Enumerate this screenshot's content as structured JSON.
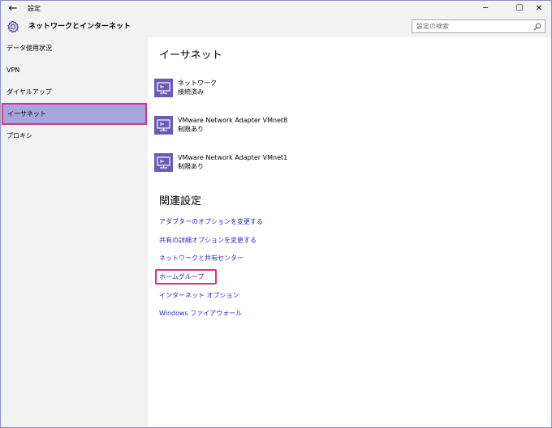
{
  "window": {
    "app_title": "設定",
    "back_glyph": "←",
    "minimize_glyph": "─",
    "maximize_glyph": "☐",
    "close_glyph": "✕"
  },
  "header": {
    "title": "ネットワークとインターネット",
    "search_placeholder": "設定の検索"
  },
  "sidebar": {
    "items": [
      {
        "label": "データ使用状況",
        "selected": false
      },
      {
        "label": "VPN",
        "selected": false
      },
      {
        "label": "ダイヤルアップ",
        "selected": false
      },
      {
        "label": "イーサネット",
        "selected": true
      },
      {
        "label": "プロキシ",
        "selected": false
      }
    ]
  },
  "main": {
    "title": "イーサネット",
    "networks": [
      {
        "name": "ネットワーク",
        "status": "接続済み",
        "icon": "ethernet-icon"
      },
      {
        "name": "VMware Network Adapter VMnet8",
        "status": "制限あり",
        "icon": "ethernet-icon"
      },
      {
        "name": "VMware Network Adapter VMnet1",
        "status": "制限あり",
        "icon": "ethernet-icon"
      }
    ],
    "related_title": "関連設定",
    "related_links": [
      "アダプターのオプションを変更する",
      "共有の詳細オプションを変更する",
      "ネットワークと共有センター",
      "ホームグループ",
      "インターネット オプション",
      "Windows ファイアウォール"
    ]
  },
  "colors": {
    "accent": "#6b5bb5",
    "selection": "#a9a3e0",
    "highlight_border": "#d3367b",
    "link": "#2c2cc7",
    "sidebar_bg": "#f2f2f2"
  }
}
